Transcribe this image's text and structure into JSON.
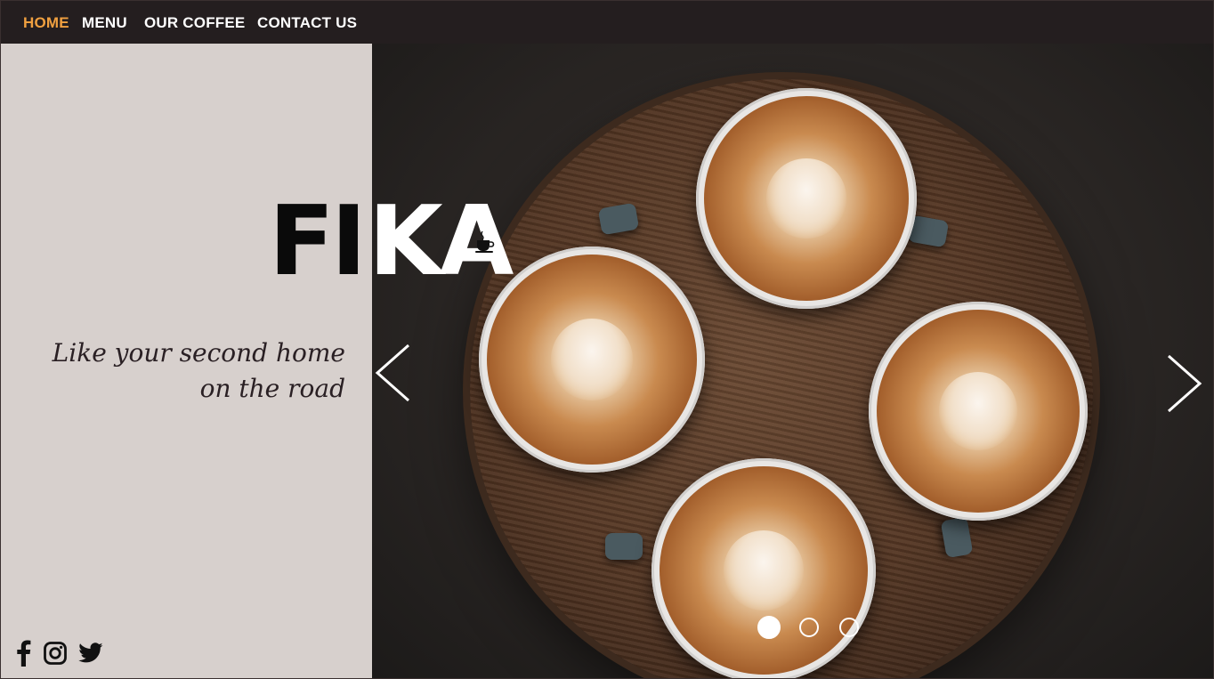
{
  "nav": {
    "items": [
      {
        "label": "HOME",
        "active": true
      },
      {
        "label": "MENU",
        "active": false
      },
      {
        "label": "OUR COFFEE",
        "active": false
      },
      {
        "label": "CONTACT US",
        "active": false
      }
    ],
    "active_color": "#f0a040"
  },
  "hero": {
    "title_part1": "FI",
    "title_part2": "KA",
    "title_icon": "coffee-cup-icon",
    "tagline_line1": "Like  your second home",
    "tagline_line2": "on the road",
    "slider": {
      "prev_icon": "chevron-left-icon",
      "next_icon": "chevron-right-icon",
      "slide_count": 3,
      "active_slide": 1
    }
  },
  "social": {
    "icons": [
      "facebook-icon",
      "instagram-icon",
      "twitter-icon"
    ]
  },
  "colors": {
    "nav_background": "#241e1f",
    "left_panel": "#d7d0cd",
    "text_dark": "#2a2024"
  }
}
